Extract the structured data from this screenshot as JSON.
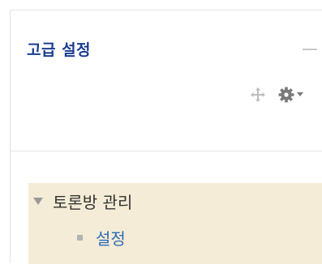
{
  "block": {
    "title": "고급 설정"
  },
  "tree": {
    "node_label": "토론방 관리",
    "children": [
      {
        "label": "설정"
      }
    ]
  },
  "colors": {
    "title": "#1a3d8f",
    "link": "#2e6bb8",
    "tree_background": "#f4ecd6"
  },
  "icons": {
    "move": "move-icon",
    "settings": "gear-icon",
    "menu_caret": "caret-down-icon",
    "collapse": "collapse-icon",
    "expanded": "triangle-down-icon",
    "bullet": "square-bullet-icon"
  }
}
